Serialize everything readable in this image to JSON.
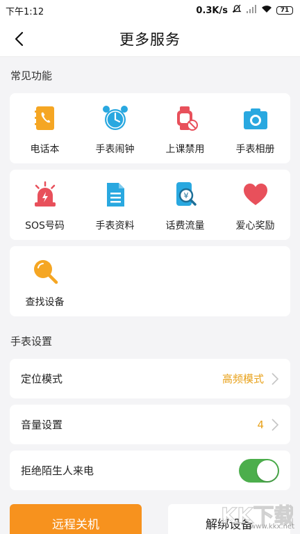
{
  "status_bar": {
    "time": "下午1:12",
    "speed": "0.3K/s",
    "battery": "71"
  },
  "header": {
    "title": "更多服务"
  },
  "common_section": {
    "title": "常见功能",
    "items": [
      {
        "label": "电话本",
        "icon": "phonebook-icon",
        "color": "#f5a623"
      },
      {
        "label": "手表闹钟",
        "icon": "alarm-clock-icon",
        "color": "#29a8e0"
      },
      {
        "label": "上课禁用",
        "icon": "watch-disabled-icon",
        "color": "#e8505b"
      },
      {
        "label": "手表相册",
        "icon": "camera-icon",
        "color": "#29a8e0"
      },
      {
        "label": "SOS号码",
        "icon": "alarm-siren-icon",
        "color": "#e8505b"
      },
      {
        "label": "手表资料",
        "icon": "document-icon",
        "color": "#29a8e0"
      },
      {
        "label": "话费流量",
        "icon": "phone-yuan-search-icon",
        "color": "#29a8e0"
      },
      {
        "label": "爱心奖励",
        "icon": "heart-icon",
        "color": "#e8505b"
      },
      {
        "label": "查找设备",
        "icon": "magnifier-icon",
        "color": "#f5a623"
      }
    ]
  },
  "watch_section": {
    "title": "手表设置",
    "location_mode": {
      "label": "定位模式",
      "value": "高频模式"
    },
    "volume": {
      "label": "音量设置",
      "value": "4"
    },
    "reject_strangers": {
      "label": "拒绝陌生人来电",
      "on": true
    }
  },
  "buttons": {
    "power_off": "远程关机",
    "unbind": "解绑设备"
  },
  "watermark": {
    "logo_text": "KK下载",
    "url": "www.kkx.net"
  },
  "colors": {
    "accent_orange": "#f7921e",
    "value_orange": "#e8a11a",
    "toggle_green": "#4cae4c"
  }
}
